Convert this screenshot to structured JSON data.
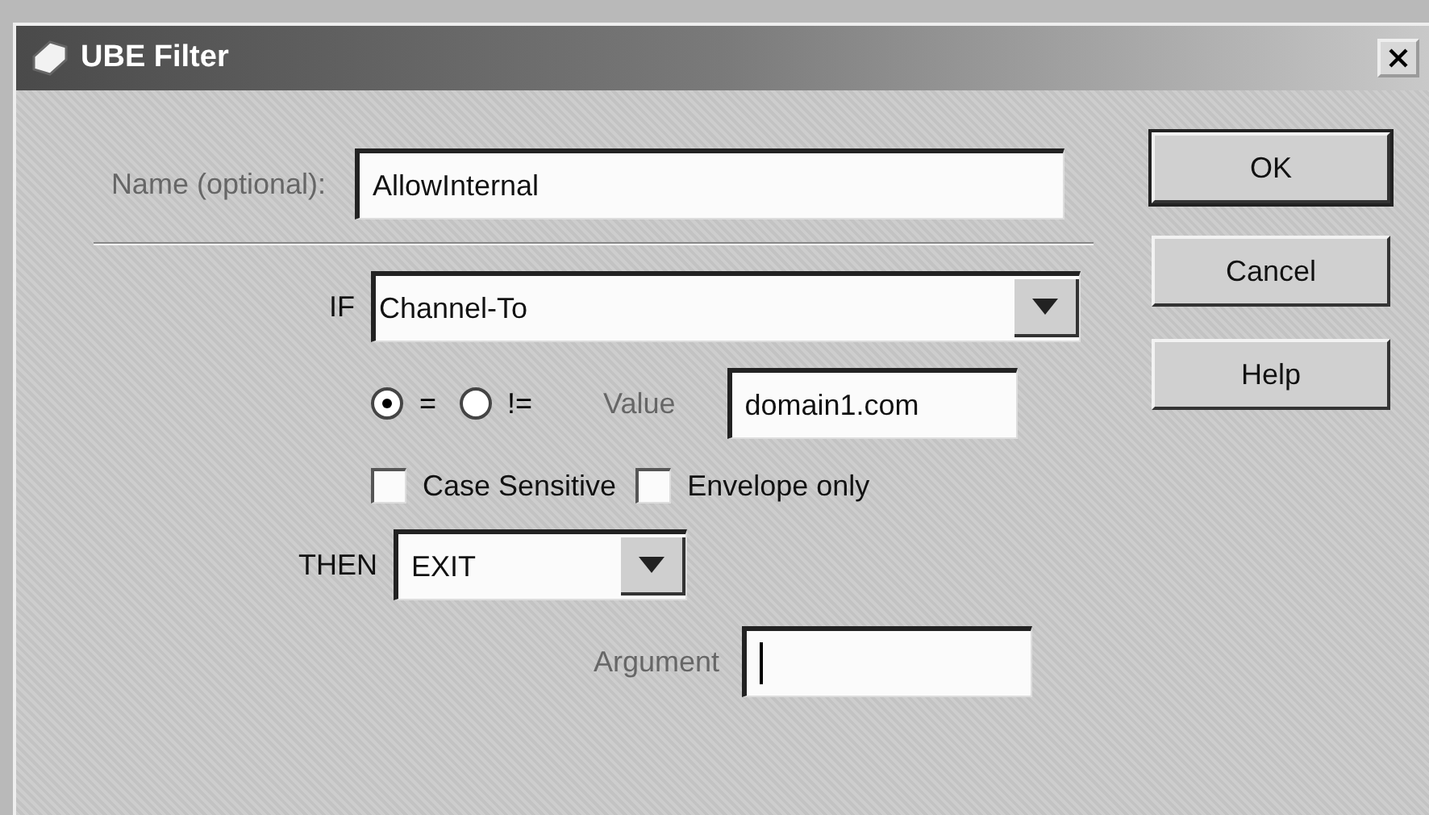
{
  "window": {
    "title": "UBE Filter"
  },
  "name_field": {
    "label": "Name (optional):",
    "value": "AllowInternal"
  },
  "if_field": {
    "label": "IF",
    "value": "Channel-To"
  },
  "operators": [
    {
      "label": "=",
      "selected": true
    },
    {
      "label": "!=",
      "selected": false
    }
  ],
  "value_field": {
    "label": "Value",
    "value": "domain1.com"
  },
  "options": [
    {
      "label": "Case Sensitive",
      "checked": false
    },
    {
      "label": "Envelope only",
      "checked": false
    }
  ],
  "then_field": {
    "label": "THEN",
    "value": "EXIT"
  },
  "argument_field": {
    "label": "Argument",
    "focused": true
  },
  "buttons": [
    {
      "label": "OK",
      "default": true
    },
    {
      "label": "Cancel",
      "default": false
    },
    {
      "label": "Help",
      "default": false
    }
  ]
}
